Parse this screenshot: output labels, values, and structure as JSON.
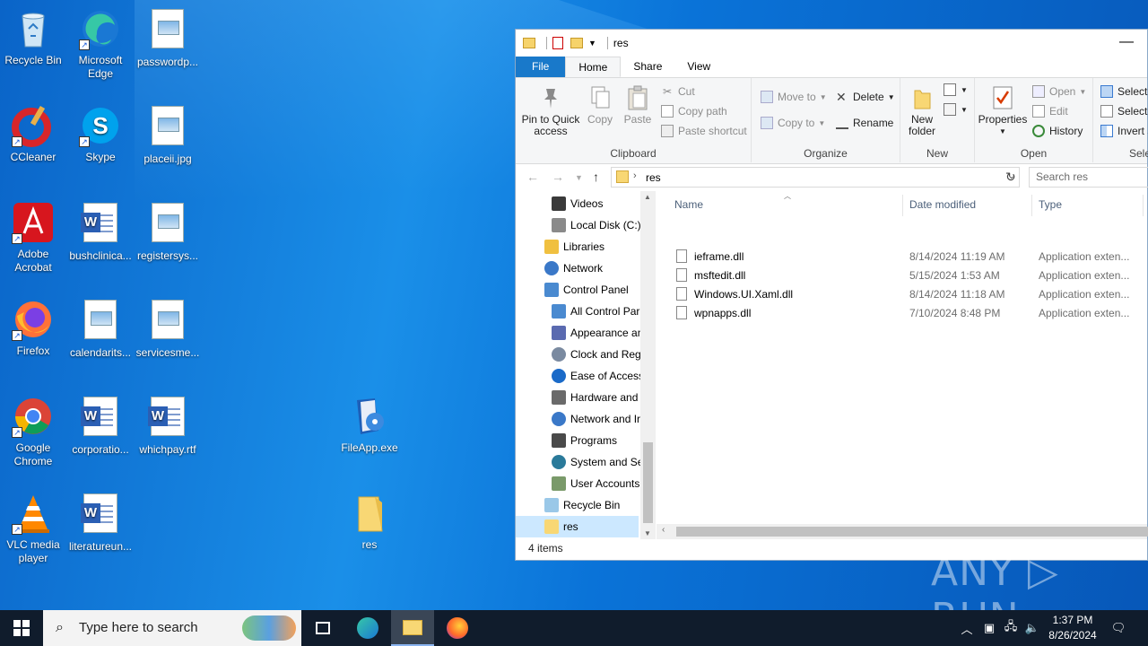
{
  "desktop": {
    "icons": [
      {
        "label": "Recycle Bin",
        "icon": "recycle-bin-icon"
      },
      {
        "label": "Microsoft Edge",
        "icon": "edge-icon"
      },
      {
        "label": "passwordp...",
        "icon": "image-file-icon"
      },
      {
        "label": "CCleaner",
        "icon": "ccleaner-icon"
      },
      {
        "label": "Skype",
        "icon": "skype-icon"
      },
      {
        "label": "placeii.jpg",
        "icon": "image-file-icon"
      },
      {
        "label": "Adobe Acrobat",
        "icon": "acrobat-icon"
      },
      {
        "label": "bushclinica...",
        "icon": "word-doc-icon"
      },
      {
        "label": "registersys...",
        "icon": "image-file-icon"
      },
      {
        "label": "Firefox",
        "icon": "firefox-icon"
      },
      {
        "label": "calendarits...",
        "icon": "image-file-icon"
      },
      {
        "label": "servicesme...",
        "icon": "image-file-icon"
      },
      {
        "label": "Google Chrome",
        "icon": "chrome-icon"
      },
      {
        "label": "corporatio...",
        "icon": "word-doc-icon"
      },
      {
        "label": "whichpay.rtf",
        "icon": "word-doc-icon"
      },
      {
        "label": "FileApp.exe",
        "icon": "app-exe-icon"
      },
      {
        "label": "VLC media player",
        "icon": "vlc-icon"
      },
      {
        "label": "literatureun...",
        "icon": "word-doc-icon"
      },
      {
        "label": "res",
        "icon": "folder-icon"
      }
    ]
  },
  "explorer": {
    "title": "res",
    "minimize": "—",
    "tabs": {
      "file": "File",
      "home": "Home",
      "share": "Share",
      "view": "View"
    },
    "ribbon": {
      "clipboard": {
        "label": "Clipboard",
        "pin": "Pin to Quick access",
        "copy": "Copy",
        "paste": "Paste",
        "cut": "Cut",
        "copy_path": "Copy path",
        "paste_shortcut": "Paste shortcut"
      },
      "organize": {
        "label": "Organize",
        "move_to": "Move to",
        "copy_to": "Copy to",
        "delete": "Delete",
        "rename": "Rename"
      },
      "new": {
        "label": "New",
        "new_folder": "New folder"
      },
      "open": {
        "label": "Open",
        "properties": "Properties",
        "open": "Open",
        "edit": "Edit",
        "history": "History"
      },
      "select": {
        "label": "Sele",
        "select_all": "Select a",
        "select_none": "Select n",
        "invert": "Invert s"
      }
    },
    "address": {
      "path": "res",
      "search_placeholder": "Search res"
    },
    "tree": [
      {
        "label": "Videos",
        "icon": "videos-icon",
        "indent": 2
      },
      {
        "label": "Local Disk (C:)",
        "icon": "disk-icon",
        "indent": 2
      },
      {
        "label": "Libraries",
        "icon": "libraries-icon",
        "indent": 1
      },
      {
        "label": "Network",
        "icon": "network-icon",
        "indent": 1
      },
      {
        "label": "Control Panel",
        "icon": "control-panel-icon",
        "indent": 1
      },
      {
        "label": "All Control Par",
        "icon": "control-panel-icon",
        "indent": 2
      },
      {
        "label": "Appearance an",
        "icon": "appearance-icon",
        "indent": 2
      },
      {
        "label": "Clock and Regi",
        "icon": "clock-icon",
        "indent": 2
      },
      {
        "label": "Ease of Access",
        "icon": "ease-of-access-icon",
        "indent": 2
      },
      {
        "label": "Hardware and",
        "icon": "hardware-icon",
        "indent": 2
      },
      {
        "label": "Network and Ir",
        "icon": "network-icon",
        "indent": 2
      },
      {
        "label": "Programs",
        "icon": "programs-icon",
        "indent": 2
      },
      {
        "label": "System and Se",
        "icon": "system-icon",
        "indent": 2
      },
      {
        "label": "User Accounts",
        "icon": "users-icon",
        "indent": 2
      },
      {
        "label": "Recycle Bin",
        "icon": "recycle-bin-icon",
        "indent": 1
      },
      {
        "label": "res",
        "icon": "folder-icon",
        "indent": 1,
        "selected": true
      }
    ],
    "columns": {
      "name": "Name",
      "date": "Date modified",
      "type": "Type"
    },
    "files": [
      {
        "name": "ieframe.dll",
        "date": "8/14/2024 11:19 AM",
        "type": "Application exten..."
      },
      {
        "name": "msftedit.dll",
        "date": "5/15/2024 1:53 AM",
        "type": "Application exten..."
      },
      {
        "name": "Windows.UI.Xaml.dll",
        "date": "8/14/2024 11:18 AM",
        "type": "Application exten..."
      },
      {
        "name": "wpnapps.dll",
        "date": "7/10/2024 8:48 PM",
        "type": "Application exten..."
      }
    ],
    "status": "4 items"
  },
  "taskbar": {
    "search_placeholder": "Type here to search",
    "time": "1:37 PM",
    "date": "8/26/2024"
  },
  "watermark": "ANY ▷ RUN"
}
